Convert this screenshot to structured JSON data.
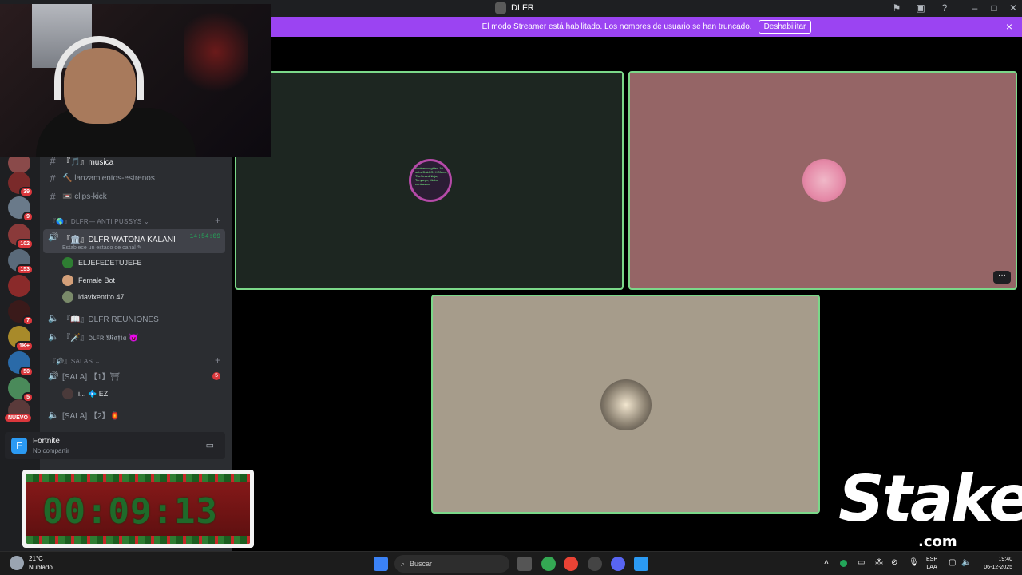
{
  "window": {
    "title": "DLFR",
    "controls": [
      "inbox-icon",
      "screen-icon",
      "help-icon",
      "minimize-icon",
      "maximize-icon",
      "close-icon"
    ]
  },
  "banner": {
    "text": "El modo Streamer está habilitado. Los nombres de usuario se han truncado.",
    "button": "Deshabilitar",
    "close_icon": "×"
  },
  "servers": [
    {
      "badge": "39"
    },
    {
      "badge": "9"
    },
    {
      "badge": "102"
    },
    {
      "badge": "153"
    },
    {
      "badge": ""
    },
    {
      "badge": "7"
    },
    {
      "badge": "1K+"
    },
    {
      "badge": "50"
    },
    {
      "badge": "5"
    }
  ],
  "server_new_label": "NUEVO",
  "channels": {
    "text_channels": [
      {
        "prefix": "#",
        "label": "『🎵』musica",
        "active": true
      },
      {
        "prefix": "#",
        "label": "🔨 lanzamientos-estrenos",
        "active": false
      },
      {
        "prefix": "#",
        "label": "📼 clips-kick",
        "active": false
      }
    ],
    "category_1": "『🌎』DLFR— ANTI PUSSYS ⌄",
    "selected_voice": {
      "name": "『🏛️』DLFR WATONA KALANI",
      "time": "14:54:09",
      "status": "Establece un estado de canal ✎"
    },
    "voice_users": [
      "ELJEFEDETUJEFE",
      "Female Bot",
      "ldavixentito.47"
    ],
    "other_voice": [
      {
        "label": "『📖』DLFR REUNIONES"
      },
      {
        "label": "『🗡️』ᴅʟꜰʀ 𝕸𝖆𝖋𝖎𝖆 👿"
      }
    ],
    "category_2": "『🔊』SALAS ⌄",
    "salas": [
      {
        "label": "[SALA] 【1】⛩",
        "count": "5"
      },
      {
        "label": "[SALA] 【2】🏮",
        "count": ""
      }
    ],
    "sala_user": "i... 💠 EZ"
  },
  "activity": {
    "icon_letter": "F",
    "game": "Fortnite",
    "status": "No compartir"
  },
  "timer": {
    "value": "00:09:13",
    "user_hint": "ELJEFEDETUJEFE"
  },
  "tiles": [
    {
      "avatar_text": "contrastcc gifted 10 subs DukOS, HOMme, TheSevedNinja, Tonysrgx, Malnd contrastcc"
    },
    {
      "avatar_text": ""
    },
    {
      "avatar_text": ""
    }
  ],
  "tile_more_icon": "···",
  "stake": {
    "logo": "Stake",
    "suffix": ".com"
  },
  "taskbar": {
    "weather_temp": "21°C",
    "weather_desc": "Nublado",
    "search_placeholder": "Buscar",
    "lang_1": "ESP",
    "lang_2": "LAA",
    "time": "19:40",
    "date": "06-12-2025"
  },
  "colors": {
    "banner": "#9b44f2",
    "speaking_border": "#7bd889",
    "badge": "#da373c",
    "online": "#23a559"
  }
}
